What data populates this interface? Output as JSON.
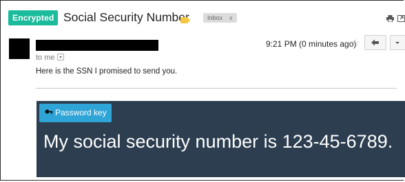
{
  "header": {
    "encrypted_badge": "Encrypted",
    "subject": "Social Security Number",
    "inbox_label": "Inbox",
    "inbox_close": "x"
  },
  "message": {
    "to_me": "to me",
    "timestamp": "9:21 PM (0 minutes ago)",
    "body": "Here is the SSN I promised to send you."
  },
  "secure": {
    "password_button": "Password key",
    "message": "My social security number is 123-45-6789."
  },
  "icons": {
    "label_tag": "label-tag-icon",
    "print": "print-icon",
    "new_window": "new-window-icon",
    "star": "star-icon",
    "reply": "reply-icon",
    "more": "chevron-down-icon",
    "key": "key-icon"
  },
  "colors": {
    "encrypted_badge": "#1abc9c",
    "label_tag": "#f4c842",
    "secure_panel": "#2c3e50",
    "password_button": "#2fa4d7"
  }
}
